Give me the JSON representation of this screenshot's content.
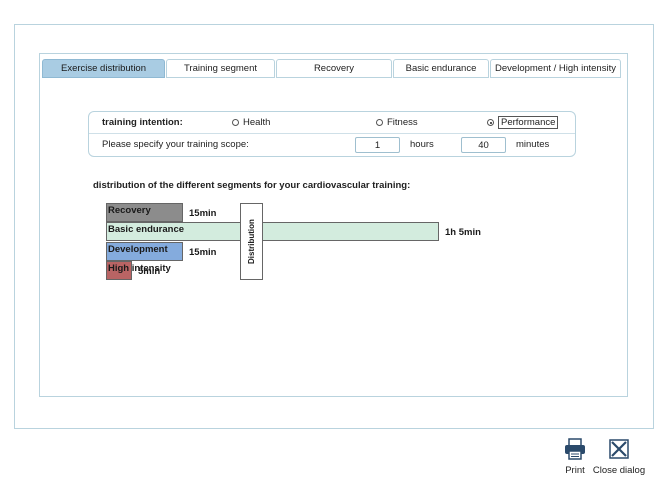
{
  "tabs": [
    {
      "label": "Exercise distribution",
      "active": true
    },
    {
      "label": "Training segment",
      "active": false
    },
    {
      "label": "Recovery",
      "active": false
    },
    {
      "label": "Basic endurance",
      "active": false
    },
    {
      "label": "Development / High intensity",
      "active": false
    }
  ],
  "intention": {
    "label": "training intention:",
    "options": [
      {
        "label": "Health",
        "checked": false
      },
      {
        "label": "Fitness",
        "checked": false
      },
      {
        "label": "Performance",
        "checked": true
      }
    ]
  },
  "scope": {
    "label": "Please specify your training scope:",
    "hours_value": "1",
    "hours_label": "hours",
    "minutes_value": "40",
    "minutes_label": "minutes"
  },
  "chart_title": "distribution of the different segments for your cardiovascular training:",
  "chart_data": {
    "type": "bar",
    "orientation": "horizontal",
    "axis_label": "Distribution",
    "categories": [
      "Recovery",
      "Basic endurance",
      "Development",
      "High intensity"
    ],
    "values_minutes": [
      15,
      65,
      15,
      5
    ],
    "value_labels": [
      "15min",
      "1h 5min",
      "15min",
      "5min"
    ],
    "colors": [
      "#8c8c8c",
      "#d3ecde",
      "#84abdd",
      "#b96464"
    ]
  },
  "footer": {
    "print_label": "Print",
    "close_label": "Close dialog"
  }
}
